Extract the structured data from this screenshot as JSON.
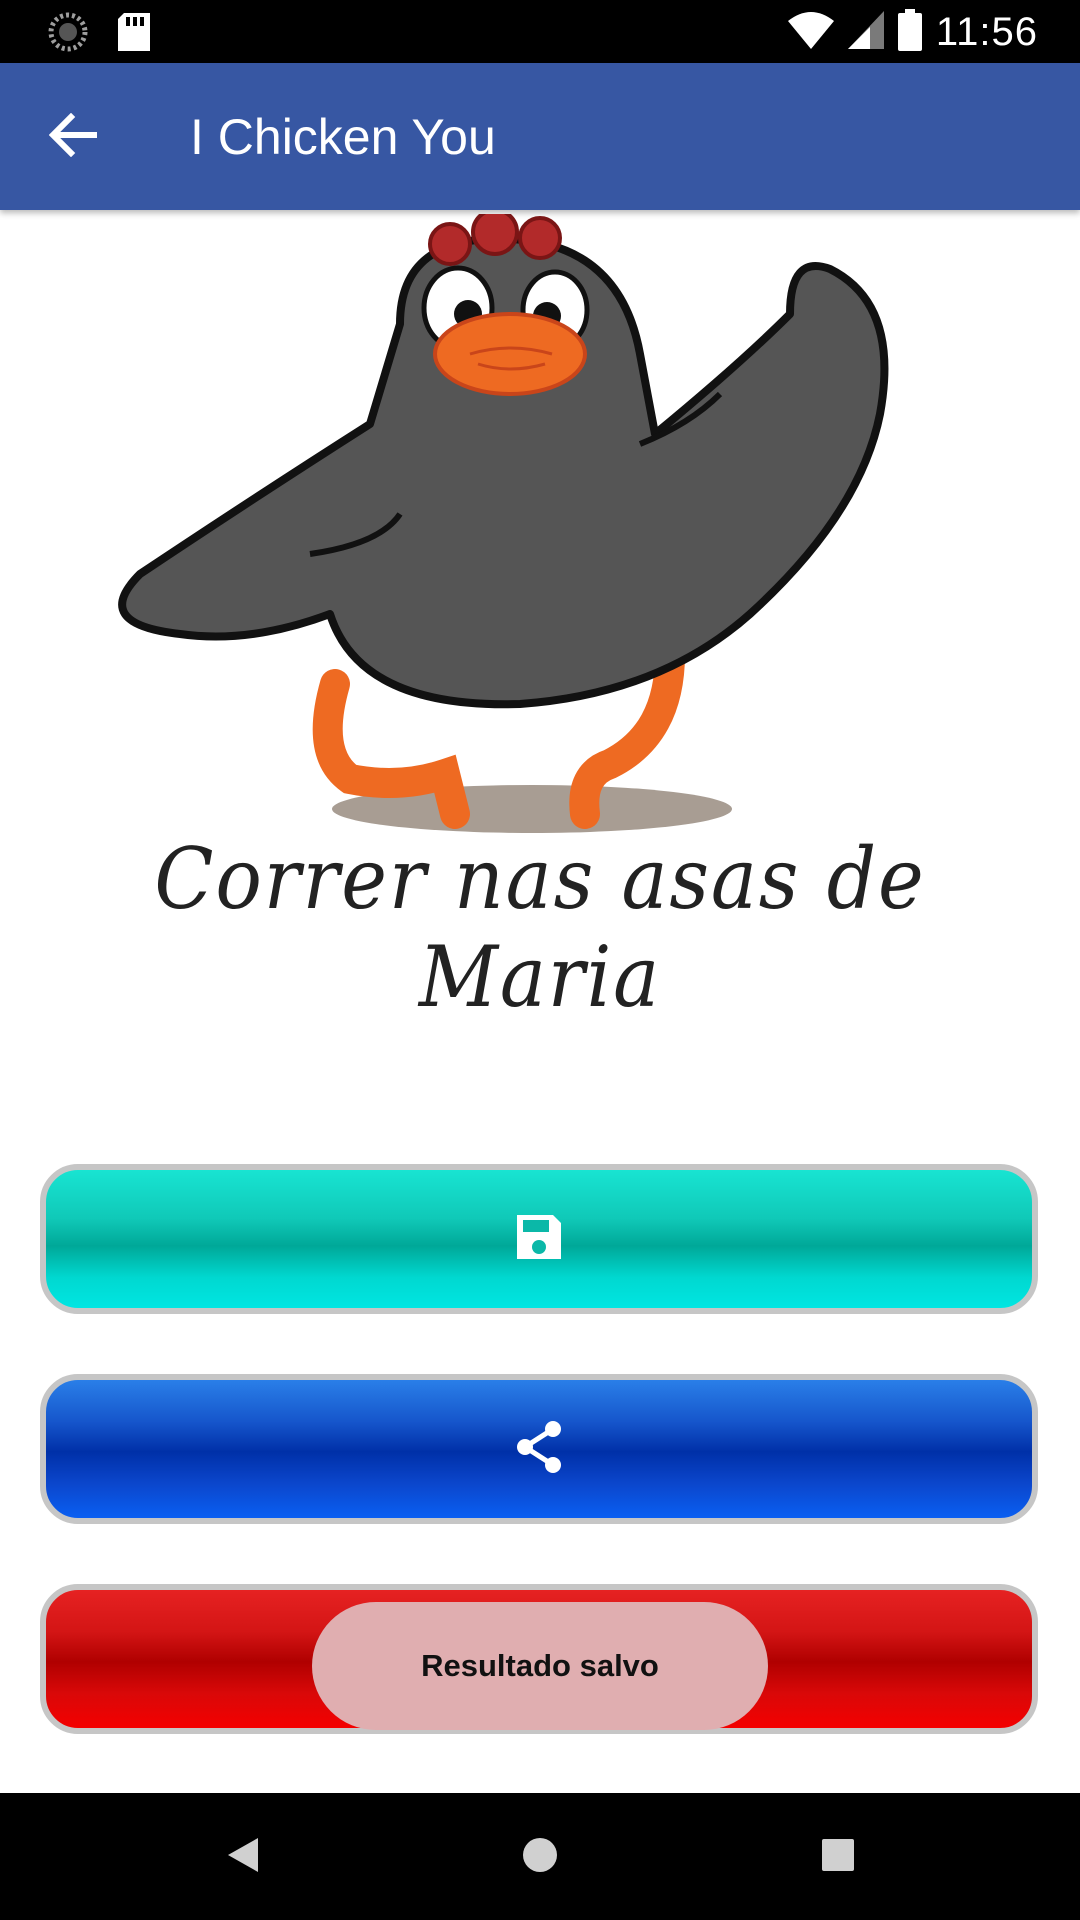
{
  "status_bar": {
    "time": "11:56",
    "left_icons": [
      "loading-icon",
      "sd-card-icon"
    ],
    "right_icons": [
      "wifi-icon",
      "signal-icon",
      "battery-icon"
    ]
  },
  "app_bar": {
    "title": "I Chicken You",
    "back_icon": "arrow-back-icon",
    "color": "#3757a3"
  },
  "content": {
    "caption": "Correr nas asas de Maria",
    "buttons": [
      {
        "name": "save-button",
        "icon": "floppy-disk-icon",
        "color": "#00a898"
      },
      {
        "name": "share-button",
        "icon": "share-icon",
        "color": "#0030a8"
      },
      {
        "name": "red-button",
        "icon": "",
        "color": "#b00000"
      }
    ]
  },
  "toast": {
    "text": "Resultado salvo"
  },
  "nav_bar": {
    "icons": [
      "back-triangle-icon",
      "home-circle-icon",
      "recents-square-icon"
    ]
  }
}
